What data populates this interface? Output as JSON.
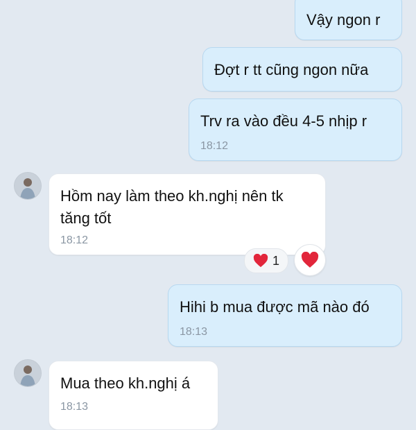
{
  "messages": [
    {
      "text": "Vậy ngon r"
    },
    {
      "text": "Đợt r tt cũng ngon nữa"
    },
    {
      "text": "Trv ra vào đều 4-5 nhịp r",
      "time": "18:12"
    },
    {
      "text": "Hồm nay làm theo kh.nghị nên tk\ntăng tốt",
      "time": "18:12",
      "reaction_count": "1"
    },
    {
      "text": "Hihi b mua được mã nào đó",
      "time": "18:13"
    },
    {
      "text": "Mua theo kh.nghị á",
      "time": "18:13"
    }
  ],
  "icons": {
    "reaction": "heart-icon",
    "react_button": "heart-icon"
  },
  "colors": {
    "outgoing_bubble": "#d9eefc",
    "incoming_bubble": "#ffffff",
    "background": "#e2e9f1",
    "heart": "#e2263b"
  }
}
